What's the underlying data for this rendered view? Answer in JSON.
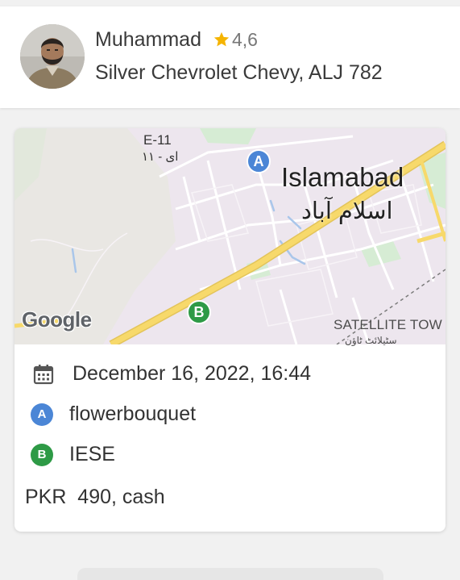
{
  "driver": {
    "name": "Muhammad",
    "rating": "4,6",
    "vehicle": "Silver Chevrolet Chevy, ALJ 782"
  },
  "map": {
    "sector_label": "E-11",
    "sector_label_urdu": "ای - ۱۱",
    "city_label": "Islamabad",
    "city_label_urdu": "اسلام آباد",
    "satellite_label": "SATELLITE TOW",
    "satellite_label_urdu": "سٹیلائٹ ٹاؤن",
    "google_logo": "Google",
    "pin_a": "A",
    "pin_b": "B"
  },
  "trip": {
    "datetime": "December 16, 2022, 16:44",
    "pickup_marker": "A",
    "pickup": "flowerbouquet",
    "dropoff_marker": "B",
    "dropoff": "IESE",
    "price": "PKR  490, cash"
  },
  "colors": {
    "marker_a": "#4b86d6",
    "marker_b": "#2e9a46",
    "star": "#f5b400",
    "map_background": "#ede6ee",
    "road_yellow": "#f7d96b"
  }
}
